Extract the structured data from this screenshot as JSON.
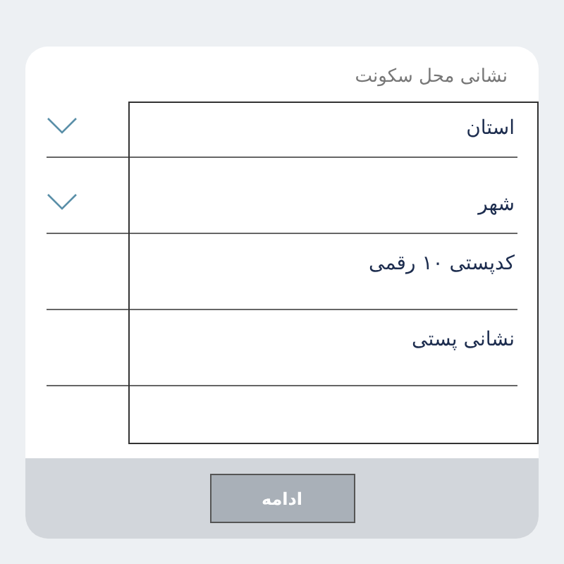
{
  "section_title": "نشانی محل سکونت",
  "fields": [
    {
      "kind": "dropdown",
      "placeholder": "استان"
    },
    {
      "kind": "dropdown",
      "placeholder": "شهر"
    },
    {
      "kind": "text",
      "placeholder": "کدپستی ۱۰ رقمی"
    },
    {
      "kind": "text",
      "placeholder": "نشانی پستی"
    }
  ],
  "continue_button": {
    "label": "ادامه",
    "disabled": true
  }
}
